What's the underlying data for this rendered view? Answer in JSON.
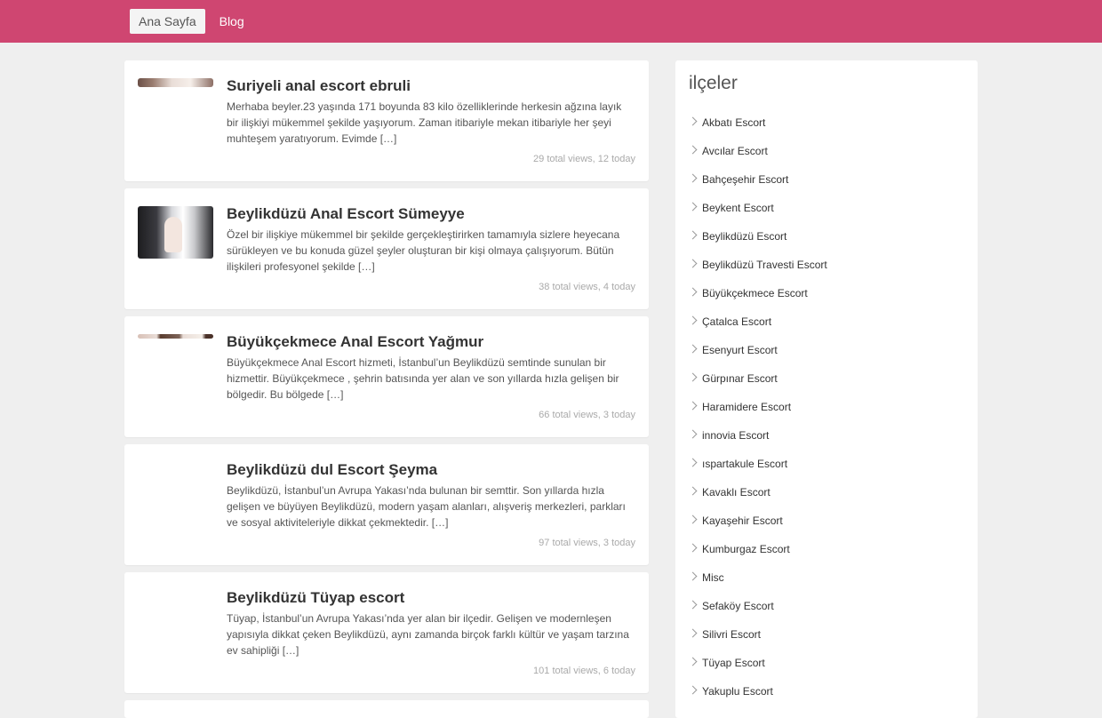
{
  "nav": {
    "items": [
      "Ana Sayfa",
      "Blog"
    ]
  },
  "posts": [
    {
      "title": "Suriyeli anal escort ebruli",
      "excerpt": "Merhaba beyler.23 yaşında 171 boyunda 83 kilo özelliklerinde herkesin ağzına layık bir ilişkiyi mükemmel şekilde yaşıyorum. Zaman itibariyle mekan itibariyle her şeyi muhteşem yaratıyorum. Evimde […]",
      "views": "29 total views, 12 today"
    },
    {
      "title": "Beylikdüzü Anal Escort Sümeyye",
      "excerpt": "Özel bir ilişkiye mükemmel bir şekilde gerçekleştirirken tamamıyla sizlere heyecana sürükleyen ve bu konuda güzel şeyler oluşturan bir kişi olmaya çalışıyorum. Bütün ilişkileri profesyonel şekilde […]",
      "views": "38 total views, 4 today"
    },
    {
      "title": "Büyükçekmece Anal Escort Yağmur",
      "excerpt": "Büyükçekmece Anal Escort hizmeti, İstanbul’un Beylikdüzü semtinde sunulan bir hizmettir. Büyükçekmece , şehrin batısında yer alan ve son yıllarda hızla gelişen bir bölgedir. Bu bölgede […]",
      "views": "66 total views, 3 today"
    },
    {
      "title": "Beylikdüzü dul Escort Şeyma",
      "excerpt": "Beylikdüzü, İstanbul’un Avrupa Yakası’nda bulunan bir semttir. Son yıllarda hızla gelişen ve büyüyen Beylikdüzü, modern yaşam alanları, alışveriş merkezleri, parkları ve sosyal aktiviteleriyle dikkat çekmektedir. […]",
      "views": "97 total views, 3 today"
    },
    {
      "title": "Beylikdüzü Tüyap escort",
      "excerpt": "Tüyap, İstanbul’un Avrupa Yakası’nda yer alan bir ilçedir. Gelişen ve modernleşen yapısıyla dikkat çeken Beylikdüzü, aynı zamanda birçok farklı kültür ve yaşam tarzına ev sahipliği […]",
      "views": "101 total views, 6 today"
    }
  ],
  "sidebar": {
    "title": "ilçeler",
    "districts": [
      "Akbatı Escort",
      "Avcılar Escort",
      "Bahçeşehir Escort",
      "Beykent Escort",
      "Beylikdüzü Escort",
      "Beylikdüzü Travesti Escort",
      "Büyükçekmece Escort",
      "Çatalca Escort",
      "Esenyurt Escort",
      "Gürpınar Escort",
      "Haramidere Escort",
      "innovia Escort",
      "ıspartakule Escort",
      "Kavaklı Escort",
      "Kayaşehir Escort",
      "Kumburgaz Escort",
      "Misc",
      "Sefaköy Escort",
      "Silivri Escort",
      "Tüyap Escort",
      "Yakuplu Escort"
    ]
  }
}
